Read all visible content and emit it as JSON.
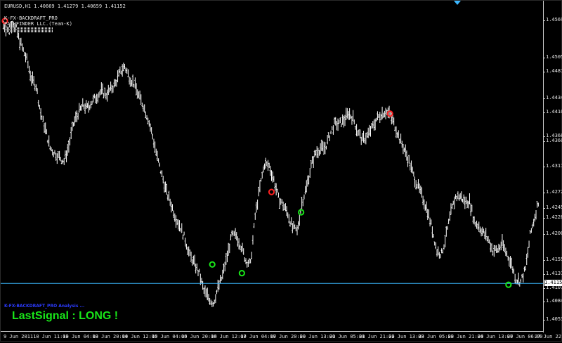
{
  "chart": {
    "symbol_line": "EURUSD,H1  1.40669 1.41279 1.40659 1.41152",
    "indicator_name": "K-FX-BACKDRAFT_PRO",
    "indicator_vendor": "PATHFINDER LLC.(Team-K)",
    "status_line": "K-FX-BACKDRAFT_PRO Analysis ...",
    "last_signal": "LastSignal : LONG !",
    "current_price": "1.41152",
    "colors": {
      "background": "#000000",
      "bars": "#ffffff",
      "long_signal": "#19e619",
      "short_signal": "#ff2020",
      "current_price_line": "#3bb7ff",
      "status_text": "#2b3bff"
    }
  },
  "chart_data": {
    "type": "ohlc",
    "title": "EURUSD,H1",
    "y_tick_labels": [
      "1.45695",
      "1.45050",
      "1.44810",
      "1.44345",
      "1.44100",
      "1.43685",
      "1.43605",
      "1.43170",
      "1.42720",
      "1.42455",
      "1.42280",
      "1.42005",
      "1.41550",
      "1.41315",
      "1.41075",
      "1.40845",
      "1.40530"
    ],
    "x_tick_labels": [
      "9 Jun 2011",
      "10 Jun 11:00",
      "13 Jun 04:00",
      "13 Jun 20:00",
      "14 Jun 12:00",
      "15 Jun 04:00",
      "15 Jun 20:00",
      "16 Jun 12:00",
      "17 Jun 04:00",
      "17 Jun 20:00",
      "20 Jun 13:00",
      "21 Jun 05:00",
      "21 Jun 21:00",
      "22 Jun 13:00",
      "23 Jun 05:00",
      "23 Jun 21:00",
      "24 Jun 13:00",
      "27 Jun 06:00",
      "27 Jun 22:00"
    ],
    "ylim": [
      1.4038,
      1.4598
    ],
    "close_path": [
      1.4561,
      1.4552,
      1.4566,
      1.4544,
      1.4522,
      1.4501,
      1.4468,
      1.4456,
      1.4408,
      1.4381,
      1.4349,
      1.434,
      1.4333,
      1.4326,
      1.4352,
      1.439,
      1.4409,
      1.4422,
      1.4418,
      1.4429,
      1.4438,
      1.4447,
      1.4441,
      1.445,
      1.446,
      1.4479,
      1.449,
      1.4471,
      1.446,
      1.4439,
      1.4422,
      1.44,
      1.4369,
      1.4332,
      1.4302,
      1.4272,
      1.4251,
      1.4228,
      1.4212,
      1.419,
      1.4163,
      1.4149,
      1.4132,
      1.4102,
      1.4091,
      1.4081,
      1.4107,
      1.4129,
      1.4163,
      1.4198,
      1.4197,
      1.4179,
      1.4155,
      1.4148,
      1.4231,
      1.4281,
      1.4321,
      1.4318,
      1.4294,
      1.4262,
      1.4251,
      1.4236,
      1.4211,
      1.4205,
      1.4254,
      1.4281,
      1.4318,
      1.4341,
      1.4348,
      1.4349,
      1.4371,
      1.439,
      1.439,
      1.4396,
      1.4409,
      1.44,
      1.4377,
      1.4362,
      1.437,
      1.4382,
      1.4398,
      1.4408,
      1.4412,
      1.4405,
      1.4387,
      1.4365,
      1.4346,
      1.4326,
      1.4301,
      1.4281,
      1.4262,
      1.424,
      1.4208,
      1.4171,
      1.4166,
      1.4199,
      1.4238,
      1.4264,
      1.4266,
      1.4256,
      1.4257,
      1.4222,
      1.4214,
      1.4202,
      1.4191,
      1.4172,
      1.4173,
      1.4184,
      1.4166,
      1.4148,
      1.4122,
      1.4119,
      1.414,
      1.4198,
      1.4231,
      1.4265
    ],
    "signals": [
      {
        "type": "short",
        "x": "9 Jun 2011",
        "price": 1.4568
      },
      {
        "type": "long",
        "x": "16 Jun 12:00",
        "price": 1.4148
      },
      {
        "type": "long",
        "x": "17 Jun 04:00",
        "price": 1.4133
      },
      {
        "type": "short",
        "x": "17 Jun 20:00",
        "price": 1.4273
      },
      {
        "type": "long",
        "x": "20 Jun 13:00",
        "price": 1.4238
      },
      {
        "type": "short",
        "x": "22 Jun 13:00",
        "price": 1.4408
      },
      {
        "type": "long",
        "x": "27 Jun 06:00",
        "price": 1.4113
      }
    ]
  }
}
